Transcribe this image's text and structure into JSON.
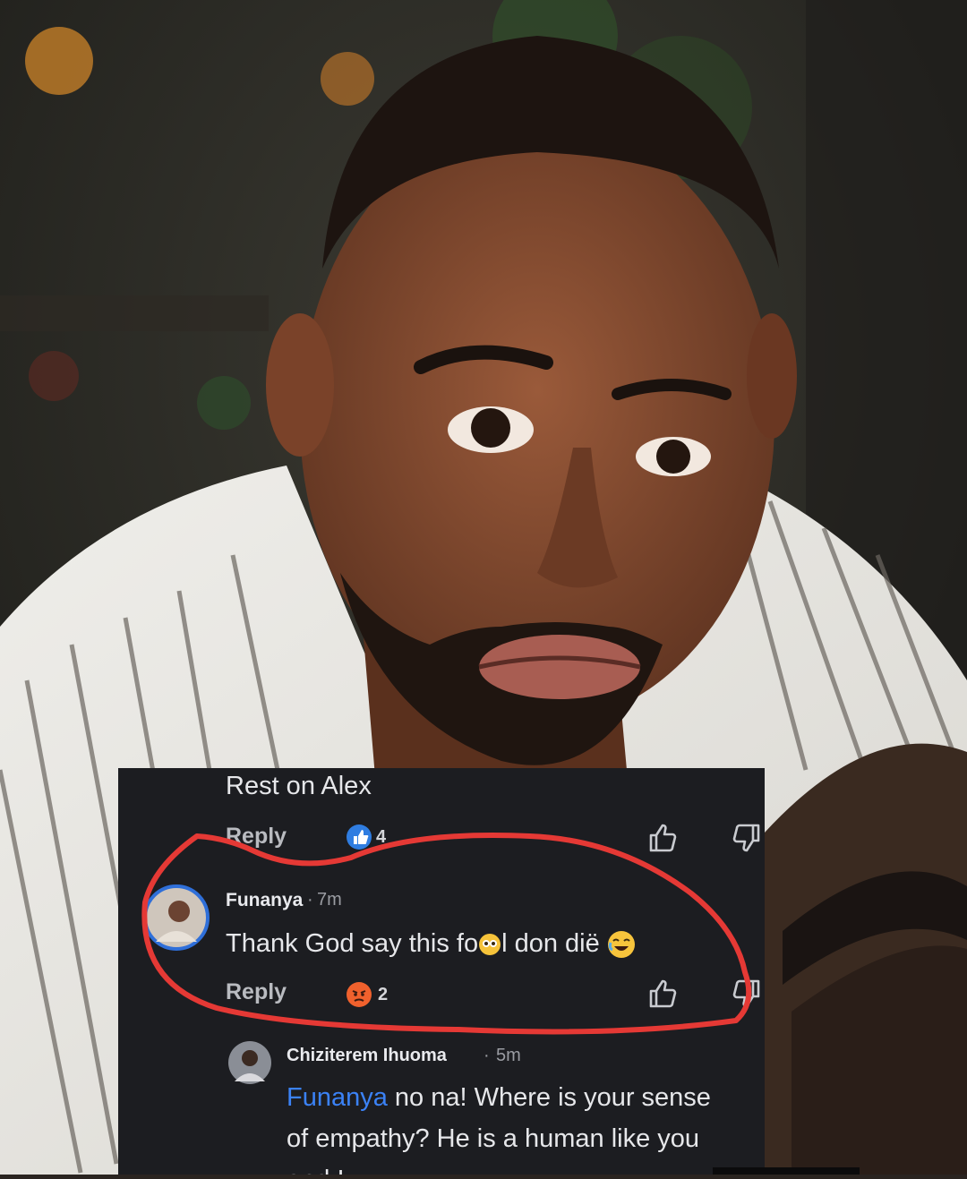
{
  "comments": [
    {
      "text": "Rest on Alex",
      "reply_label": "Reply",
      "reaction_count": "4",
      "reaction_icon": "like-reaction-icon"
    },
    {
      "author": "Funanya",
      "time": "7m",
      "text": "Thank God say this fo",
      "text_tail": "l don diё",
      "reply_label": "Reply",
      "reaction_count": "2",
      "reaction_icon": "angry-reaction-icon",
      "highlight_color": "#e53935"
    },
    {
      "author": "Chiziterem Ihuoma",
      "time": "5m",
      "mention": "Funanya",
      "line1": " no na! Where is your sense",
      "line2": "of empathy? He is a human like you",
      "line3": "and I"
    }
  ],
  "colors": {
    "panel_bg": "#1c1d21",
    "accent": "#3b82f6",
    "circle": "#e53935"
  }
}
